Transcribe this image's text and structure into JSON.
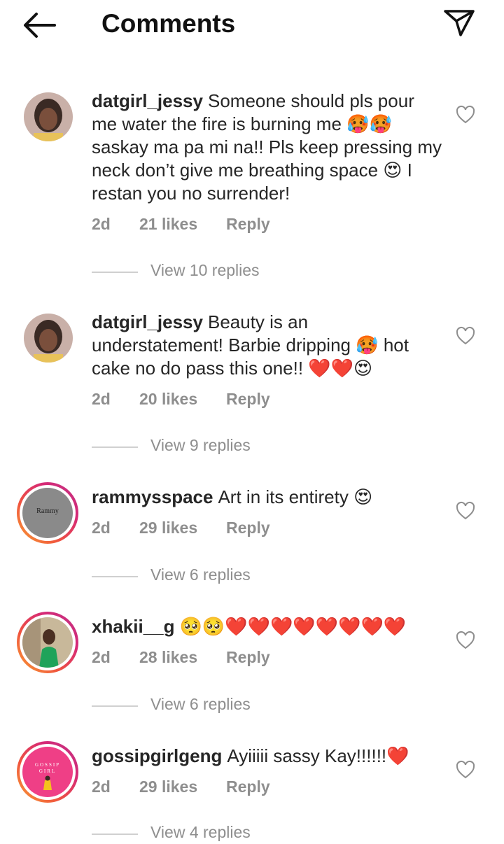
{
  "header": {
    "title": "Comments"
  },
  "comments": [
    {
      "username": "datgirl_jessy",
      "text": "Someone should pls pour me water the fire is burning me 🥵🥵 saskay ma pa mi na!! Pls keep pressing my neck don’t give me breathing space 😍 I restan you no surrender!",
      "time": "2d",
      "likes": "21 likes",
      "reply": "Reply",
      "view_replies": "View 10 replies"
    },
    {
      "username": "datgirl_jessy",
      "text": "Beauty is an understatement! Barbie dripping 🥵 hot cake no do pass this one!! ❤️❤️😍",
      "time": "2d",
      "likes": "20 likes",
      "reply": "Reply",
      "view_replies": "View 9 replies"
    },
    {
      "username": "rammysspace",
      "avatar_label": "Rammy",
      "text": "Art in its entirety 😍",
      "time": "2d",
      "likes": "29 likes",
      "reply": "Reply",
      "view_replies": "View 6 replies"
    },
    {
      "username": "xhakii__g",
      "text": "🥺🥺❤️❤️❤️❤️❤️❤️❤️❤️",
      "time": "2d",
      "likes": "28 likes",
      "reply": "Reply",
      "view_replies": "View 6 replies"
    },
    {
      "username": "gossipgirlgeng",
      "avatar_label": "GOSSIP GIRL",
      "text": "Ayiiiii sassy Kay!!!!!!❤️",
      "time": "2d",
      "likes": "29 likes",
      "reply": "Reply",
      "view_replies": "View 4 replies"
    }
  ],
  "colors": {
    "secondary_text": "#8e8e8e",
    "story_ring": "#d62976"
  },
  "icons": {
    "back": "arrow-left-icon",
    "share": "paper-plane-icon",
    "like": "heart-outline-icon"
  }
}
